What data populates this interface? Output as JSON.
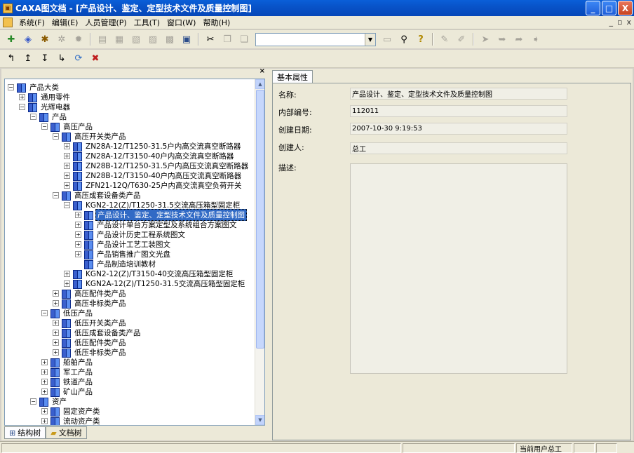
{
  "window": {
    "app_name": "CAXA图文档",
    "title": "CAXA图文档 - [产品设计、鉴定、定型技术文件及质量控制图]",
    "btn_min": "_",
    "btn_max": "□",
    "btn_close": "X"
  },
  "menu": {
    "items": [
      "系统(F)",
      "编辑(E)",
      "人员管理(P)",
      "工具(T)",
      "窗口(W)",
      "帮助(H)"
    ],
    "mdi_min": "_",
    "mdi_restore": "▫",
    "mdi_close": "x"
  },
  "toolbar": {
    "combo_value": ""
  },
  "left_panel": {
    "close_glyph": "×",
    "tabs": [
      "结构树",
      "文档树"
    ]
  },
  "tree": [
    {
      "label": "产品大类",
      "level": 0,
      "exp": "−"
    },
    {
      "label": "通用零件",
      "level": 1,
      "exp": "+"
    },
    {
      "label": "光辉电器",
      "level": 1,
      "exp": "−"
    },
    {
      "label": "产品",
      "level": 2,
      "exp": "−"
    },
    {
      "label": "高压产品",
      "level": 3,
      "exp": "−"
    },
    {
      "label": "高压开关类产品",
      "level": 4,
      "exp": "−"
    },
    {
      "label": "ZN28A-12/T1250-31.5户内高交流真空断路器",
      "level": 5,
      "exp": "+"
    },
    {
      "label": "ZN28A-12/T3150-40户内高交流真空断路器",
      "level": 5,
      "exp": "+"
    },
    {
      "label": "ZN28B-12/T1250-31.5户内高压交流真空断路器",
      "level": 5,
      "exp": "+"
    },
    {
      "label": "ZN28B-12/T3150-40户内高压交流真空断路器",
      "level": 5,
      "exp": "+"
    },
    {
      "label": "ZFN21-12Q/T630-25户内高交流真空负荷开关",
      "level": 5,
      "exp": "+"
    },
    {
      "label": "高压成套设备类产品",
      "level": 4,
      "exp": "−"
    },
    {
      "label": "KGN2-12(Z)/T1250-31.5交流高压箱型固定柜",
      "level": 5,
      "exp": "−"
    },
    {
      "label": "产品设计、鉴定、定型技术文件及质量控制图",
      "level": 6,
      "exp": "+",
      "selected": true
    },
    {
      "label": "产品设计单台方案定型及系统组合方案图文",
      "level": 6,
      "exp": "+"
    },
    {
      "label": "产品设计历史工程系统图文",
      "level": 6,
      "exp": "+"
    },
    {
      "label": "产品设计工艺工装图文",
      "level": 6,
      "exp": "+"
    },
    {
      "label": "产品销售推广图文光盘",
      "level": 6,
      "exp": "+"
    },
    {
      "label": "产品制造培训教材",
      "level": 6,
      "exp": ""
    },
    {
      "label": "KGN2-12(Z)/T3150-40交流高压箱型固定柜",
      "level": 5,
      "exp": "+"
    },
    {
      "label": "KGN2A-12(Z)/T1250-31.5交流高压箱型固定柜",
      "level": 5,
      "exp": "+"
    },
    {
      "label": "高压配件类产品",
      "level": 4,
      "exp": "+"
    },
    {
      "label": "高压非标类产品",
      "level": 4,
      "exp": "+"
    },
    {
      "label": "低压产品",
      "level": 3,
      "exp": "−"
    },
    {
      "label": "低压开关类产品",
      "level": 4,
      "exp": "+"
    },
    {
      "label": "低压成套设备类产品",
      "level": 4,
      "exp": "+"
    },
    {
      "label": "低压配件类产品",
      "level": 4,
      "exp": "+"
    },
    {
      "label": "低压非标类产品",
      "level": 4,
      "exp": "+"
    },
    {
      "label": "船舶产品",
      "level": 3,
      "exp": "+"
    },
    {
      "label": "军工产品",
      "level": 3,
      "exp": "+"
    },
    {
      "label": "铁道产品",
      "level": 3,
      "exp": "+"
    },
    {
      "label": "矿山产品",
      "level": 3,
      "exp": "+"
    },
    {
      "label": "资产",
      "level": 2,
      "exp": "−"
    },
    {
      "label": "固定资产类",
      "level": 3,
      "exp": "+"
    },
    {
      "label": "流动资产类",
      "level": 3,
      "exp": "+"
    }
  ],
  "right_panel": {
    "tab": "基本属性",
    "props": {
      "name_label": "名称:",
      "name_value": "产品设计、鉴定、定型技术文件及质量控制图",
      "code_label": "内部编号:",
      "code_value": "112011",
      "date_label": "创建日期:",
      "date_value": "2007-10-30 9:19:53",
      "creator_label": "创建人:",
      "creator_value": "总工",
      "desc_label": "描述:",
      "desc_value": ""
    }
  },
  "status": {
    "user": "当前用户总工"
  }
}
